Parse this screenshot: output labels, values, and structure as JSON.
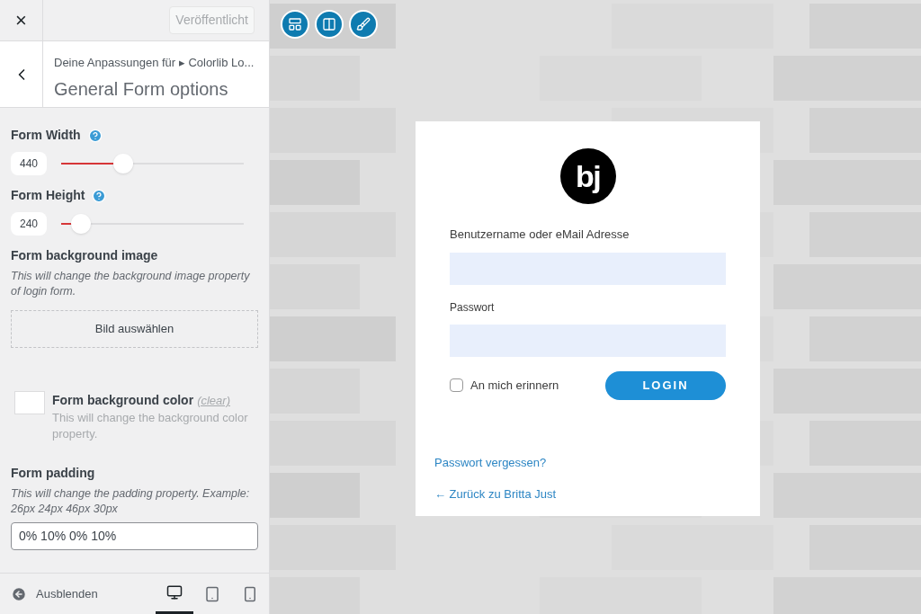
{
  "header": {
    "close": "×",
    "publish_button": {
      "label": "Veröffentlicht",
      "disabled": true
    }
  },
  "section": {
    "breadcrumb": "Deine Anpassungen für ▸ Colorlib Lo...",
    "title": "General Form options"
  },
  "controls": [
    {
      "kind": "slider",
      "label": "Form Width",
      "value": "440",
      "level": 0.34
    },
    {
      "kind": "slider",
      "label": "Form Height",
      "value": "240",
      "level": 0.11
    },
    {
      "label": "Form background image",
      "description": "This will change the background image property of login form.",
      "button": "Bild auswählen"
    },
    {
      "kind": "color",
      "label": "Form background color",
      "clear": "(clear)",
      "description": "This will change the background color property.",
      "color": "#ffffff"
    },
    {
      "kind": "text",
      "label": "Form padding",
      "description": "This will change the padding property. Example: 26px 24px 46px 30px",
      "value": "0% 10% 0% 10%"
    }
  ],
  "footer": {
    "hide_label": "Ausblenden",
    "devices": [
      {
        "kind": "desktop",
        "selected": true
      },
      {
        "kind": "tablet",
        "selected": false
      },
      {
        "kind": "mobile",
        "selected": false
      }
    ]
  },
  "preview": {
    "tools": [
      {
        "kind": "layout"
      },
      {
        "kind": "columns"
      },
      {
        "kind": "brush"
      }
    ],
    "login": {
      "logo": "bj",
      "username_label": "Benutzername oder eMail Adresse",
      "password_label": "Passwort",
      "remember": {
        "label": "An mich erinnern",
        "checked": false
      },
      "login_button": "LOGIN",
      "lost_password": "Passwort vergessen?",
      "back_link": "← Zurück zu Britta Just"
    }
  }
}
